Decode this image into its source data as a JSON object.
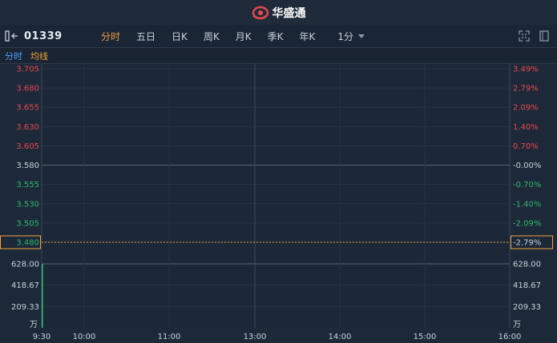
{
  "app": {
    "brand": "华盛通"
  },
  "toolbar": {
    "stock_code": "01339",
    "tabs": [
      "分时",
      "五日",
      "日K",
      "周K",
      "月K",
      "季K",
      "年K"
    ],
    "active_tab": "分时",
    "interval": "1分"
  },
  "legend": {
    "time_label": "分时",
    "avg_label": "均线"
  },
  "colors": {
    "up": "#e8474c",
    "down": "#2fb86e",
    "flat": "#c9d1dc",
    "accent": "#f2a23a",
    "link": "#4da3ff"
  },
  "icons": [
    "sidebar-collapse-icon",
    "fullscreen-icon",
    "layout-icon"
  ],
  "chart_data": {
    "type": "line",
    "price_ticks": [
      "3.705",
      "3.680",
      "3.655",
      "3.630",
      "3.605",
      "3.580",
      "3.555",
      "3.530",
      "3.505",
      "3.480"
    ],
    "price_values": [
      3.705,
      3.68,
      3.655,
      3.63,
      3.605,
      3.58,
      3.555,
      3.53,
      3.505,
      3.48
    ],
    "pct_ticks": [
      "3.49%",
      "2.79%",
      "2.09%",
      "1.40%",
      "0.70%",
      "-0.00%",
      "-0.70%",
      "-1.40%",
      "-2.09%",
      "-2.79%"
    ],
    "prev_close": 3.58,
    "current_price_label": "3.480",
    "current_pct_label": "-2.79%",
    "current_price": 3.48,
    "volume_ticks": [
      "628.00",
      "418.67",
      "209.33"
    ],
    "volume_values": [
      628.0,
      418.67,
      209.33
    ],
    "volume_unit": "万",
    "volume_max": 628.0,
    "time_labels": [
      "9:30",
      "10:00",
      "11:00",
      "13:00",
      "14:00",
      "15:00",
      "16:00"
    ],
    "volume_bars": [
      {
        "time": "9:30",
        "value": 628.0
      }
    ]
  }
}
